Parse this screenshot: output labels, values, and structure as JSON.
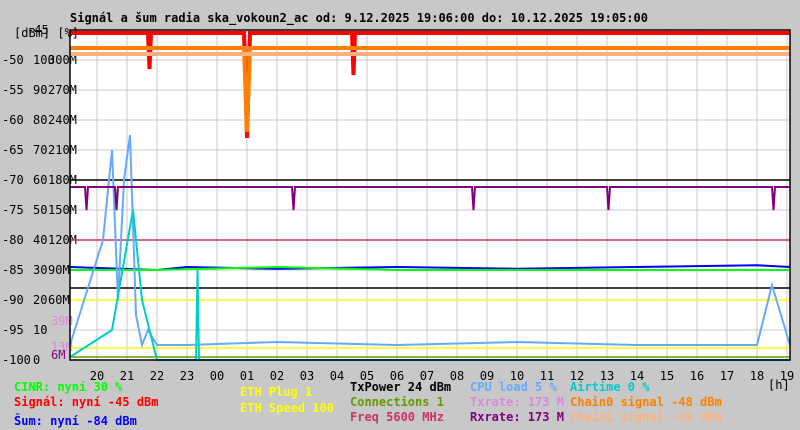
{
  "chart_data": {
    "type": "line",
    "title": "Signál a šum radia ska_vokoun2_ac od: 9.12.2025 19:06:00 do: 10.12.2025 19:05:00",
    "y_units_label": "[dBm] [%]",
    "xlabel": "[h]",
    "ylim": [
      -100,
      -45
    ],
    "x_ticks": [
      "20",
      "21",
      "22",
      "23",
      "00",
      "01",
      "02",
      "03",
      "04",
      "05",
      "06",
      "07",
      "08",
      "09",
      "10",
      "11",
      "12",
      "13",
      "14",
      "15",
      "16",
      "17",
      "18",
      "19"
    ],
    "y_ticks_dbm": [
      "-45",
      "-50",
      "-55",
      "-60",
      "-65",
      "-70",
      "-75",
      "-80",
      "-85",
      "-90",
      "-95",
      "-100"
    ],
    "y_ticks_pct": [
      "100",
      "90",
      "80",
      "70",
      "60",
      "50",
      "40",
      "30",
      "20",
      "10",
      "0"
    ],
    "y_ticks_rate": [
      "300M",
      "270M",
      "240M",
      "210M",
      "180M",
      "150M",
      "120M",
      "90M",
      "60M"
    ],
    "rate_marks": [
      {
        "label": "39M",
        "color": "#dd88dd"
      },
      {
        "label": "13M",
        "color": "#dd88dd"
      },
      {
        "label": "6M",
        "color": "#800080"
      }
    ],
    "grid": true,
    "series": [
      {
        "name": "Signál",
        "color": "#ff0000",
        "unit": "dBm",
        "x": [
          19.1,
          21.7,
          21.75,
          21.8,
          24.9,
          25.0,
          25.1,
          28.5,
          28.55,
          28.6,
          43.1
        ],
        "y": [
          -45.5,
          -45.5,
          -51.5,
          -45.5,
          -45.5,
          -63,
          -45.5,
          -45.5,
          -52.5,
          -45.5,
          -45.5
        ]
      },
      {
        "name": "Chain0 signal",
        "color": "#ff8000",
        "unit": "dBm",
        "x": [
          19.1,
          24.9,
          25.0,
          25.1,
          43.1
        ],
        "y": [
          -48,
          -48,
          -62,
          -48,
          -48
        ]
      },
      {
        "name": "Chain1 signal",
        "color": "#ffb080",
        "unit": "dBm",
        "x": [
          19.1,
          43.1
        ],
        "y": [
          -49,
          -49
        ]
      },
      {
        "name": "Šum",
        "color": "#0000ff",
        "unit": "dBm",
        "x": [
          19.1,
          22,
          23,
          26,
          30,
          34,
          38,
          42,
          43.1
        ],
        "y": [
          -84.5,
          -85,
          -84.5,
          -84.8,
          -84.5,
          -84.8,
          -84.5,
          -84.2,
          -84.5
        ]
      },
      {
        "name": "CINR",
        "color": "#00ff00",
        "unit": "%",
        "x": [
          19.1,
          22,
          26,
          30,
          34,
          38,
          43.1
        ],
        "y": [
          30,
          30,
          31,
          30,
          30,
          30,
          30
        ]
      },
      {
        "name": "CPU load",
        "color": "#66aaff",
        "unit": "%",
        "x": [
          19.1,
          20.2,
          20.5,
          20.7,
          20.9,
          21.1,
          21.3,
          21.5,
          21.7,
          22,
          23,
          26,
          30,
          34,
          38,
          42,
          42.5,
          43.1
        ],
        "y": [
          5,
          40,
          70,
          20,
          60,
          75,
          15,
          5,
          10,
          5,
          5,
          6,
          5,
          6,
          5,
          5,
          25,
          5
        ]
      },
      {
        "name": "Airtime",
        "color": "#00cccc",
        "unit": "%",
        "x": [
          19.1,
          20.5,
          21.2,
          21.5,
          22,
          23.3,
          23.35,
          23.4,
          43.1
        ],
        "y": [
          1,
          10,
          50,
          20,
          0,
          0,
          30,
          0,
          0
        ]
      },
      {
        "name": "Rxrate",
        "color": "#800080",
        "unit": "M",
        "x": [
          19.1,
          19.6,
          19.65,
          19.7,
          20.6,
          20.65,
          20.7,
          26.5,
          26.55,
          26.6,
          32.5,
          32.55,
          32.6,
          37.0,
          37.05,
          37.1,
          42.5,
          42.55,
          42.6,
          43.1
        ],
        "y": [
          173,
          173,
          150,
          173,
          173,
          150,
          173,
          173,
          150,
          173,
          173,
          150,
          173,
          173,
          150,
          173,
          173,
          150,
          173,
          173
        ]
      }
    ],
    "ref_lines": [
      {
        "name": "TxPower",
        "color": "#000000",
        "value_pct": 60
      },
      {
        "name": "Freq",
        "color": "#cc3366",
        "value_pct": 40
      },
      {
        "name": "ETH Speed",
        "color": "#ffff00",
        "value_pct": 20
      },
      {
        "name": "ETH Plug",
        "color": "#ffff00",
        "value_pct": 4
      },
      {
        "name": "TxPower2",
        "color": "#000000",
        "value_pct": 24
      },
      {
        "name": "Connections",
        "color": "#669900",
        "value_pct": 1
      }
    ]
  },
  "legend": {
    "cinr": "CINR: nyní 30 %",
    "signal": "Signál: nyní -45 dBm",
    "noise": "Šum: nyní -84 dBm",
    "eth_plug": "ETH Plug 1",
    "eth_speed": "ETH Speed 100",
    "txpower": "TxPower 24 dBm",
    "connections": "Connections 1",
    "freq": "Freq 5600 MHz",
    "cpu": "CPU load 5 %",
    "txrate": "Txrate: 173 M",
    "rxrate": "Rxrate: 173 M",
    "airtime": "Airtime 0 %",
    "chain0": "Chain0 signal -48 dBm",
    "chain1": "Chain1 signal -49 dBm"
  }
}
